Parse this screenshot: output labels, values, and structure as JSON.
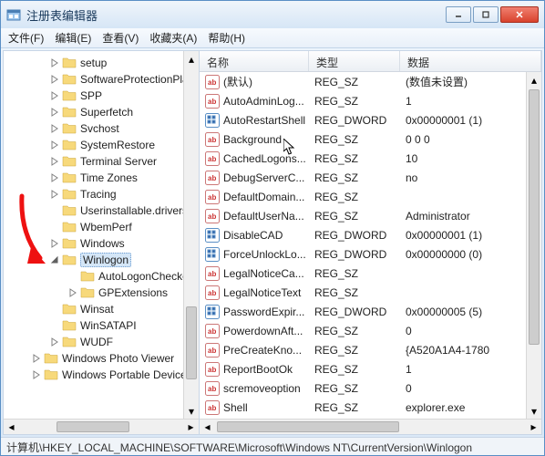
{
  "window": {
    "title": "注册表编辑器"
  },
  "menu": {
    "file": "文件(F)",
    "edit": "编辑(E)",
    "view": "查看(V)",
    "favorites": "收藏夹(A)",
    "help": "帮助(H)"
  },
  "columns": {
    "name": "名称",
    "type": "类型",
    "data": "数据"
  },
  "col_widths": {
    "name": 120,
    "type": 100,
    "data": 130
  },
  "tree": [
    {
      "label": "setup",
      "indent": 50,
      "exp": "c"
    },
    {
      "label": "SoftwareProtectionPla",
      "indent": 50,
      "exp": "c"
    },
    {
      "label": "SPP",
      "indent": 50,
      "exp": "c"
    },
    {
      "label": "Superfetch",
      "indent": 50,
      "exp": "c"
    },
    {
      "label": "Svchost",
      "indent": 50,
      "exp": "c"
    },
    {
      "label": "SystemRestore",
      "indent": 50,
      "exp": "c"
    },
    {
      "label": "Terminal Server",
      "indent": 50,
      "exp": "c"
    },
    {
      "label": "Time Zones",
      "indent": 50,
      "exp": "c"
    },
    {
      "label": "Tracing",
      "indent": 50,
      "exp": "c"
    },
    {
      "label": "Userinstallable.drivers",
      "indent": 50,
      "exp": ""
    },
    {
      "label": "WbemPerf",
      "indent": 50,
      "exp": ""
    },
    {
      "label": "Windows",
      "indent": 50,
      "exp": "c"
    },
    {
      "label": "Winlogon",
      "indent": 50,
      "exp": "o",
      "selected": true
    },
    {
      "label": "AutoLogonChecke",
      "indent": 70,
      "exp": ""
    },
    {
      "label": "GPExtensions",
      "indent": 70,
      "exp": "c"
    },
    {
      "label": "Winsat",
      "indent": 50,
      "exp": ""
    },
    {
      "label": "WinSATAPI",
      "indent": 50,
      "exp": ""
    },
    {
      "label": "WUDF",
      "indent": 50,
      "exp": "c"
    },
    {
      "label": "Windows Photo Viewer",
      "indent": 30,
      "exp": "c"
    },
    {
      "label": "Windows Portable Devices",
      "indent": 30,
      "exp": "c"
    }
  ],
  "values": [
    {
      "name": "(默认)",
      "type": "REG_SZ",
      "data": "(数值未设置)",
      "icon": "sz"
    },
    {
      "name": "AutoAdminLog...",
      "type": "REG_SZ",
      "data": "1",
      "icon": "sz"
    },
    {
      "name": "AutoRestartShell",
      "type": "REG_DWORD",
      "data": "0x00000001 (1)",
      "icon": "dw"
    },
    {
      "name": "Background",
      "type": "REG_SZ",
      "data": "0 0 0",
      "icon": "sz"
    },
    {
      "name": "CachedLogons...",
      "type": "REG_SZ",
      "data": "10",
      "icon": "sz"
    },
    {
      "name": "DebugServerC...",
      "type": "REG_SZ",
      "data": "no",
      "icon": "sz"
    },
    {
      "name": "DefaultDomain...",
      "type": "REG_SZ",
      "data": "",
      "icon": "sz"
    },
    {
      "name": "DefaultUserNa...",
      "type": "REG_SZ",
      "data": "Administrator",
      "icon": "sz"
    },
    {
      "name": "DisableCAD",
      "type": "REG_DWORD",
      "data": "0x00000001 (1)",
      "icon": "dw"
    },
    {
      "name": "ForceUnlockLo...",
      "type": "REG_DWORD",
      "data": "0x00000000 (0)",
      "icon": "dw"
    },
    {
      "name": "LegalNoticeCa...",
      "type": "REG_SZ",
      "data": "",
      "icon": "sz"
    },
    {
      "name": "LegalNoticeText",
      "type": "REG_SZ",
      "data": "",
      "icon": "sz"
    },
    {
      "name": "PasswordExpir...",
      "type": "REG_DWORD",
      "data": "0x00000005 (5)",
      "icon": "dw"
    },
    {
      "name": "PowerdownAft...",
      "type": "REG_SZ",
      "data": "0",
      "icon": "sz"
    },
    {
      "name": "PreCreateKno...",
      "type": "REG_SZ",
      "data": "{A520A1A4-1780",
      "icon": "sz"
    },
    {
      "name": "ReportBootOk",
      "type": "REG_SZ",
      "data": "1",
      "icon": "sz"
    },
    {
      "name": "scremoveoption",
      "type": "REG_SZ",
      "data": "0",
      "icon": "sz"
    },
    {
      "name": "Shell",
      "type": "REG_SZ",
      "data": "explorer.exe",
      "icon": "sz"
    }
  ],
  "statusbar": "计算机\\HKEY_LOCAL_MACHINE\\SOFTWARE\\Microsoft\\Windows NT\\CurrentVersion\\Winlogon"
}
